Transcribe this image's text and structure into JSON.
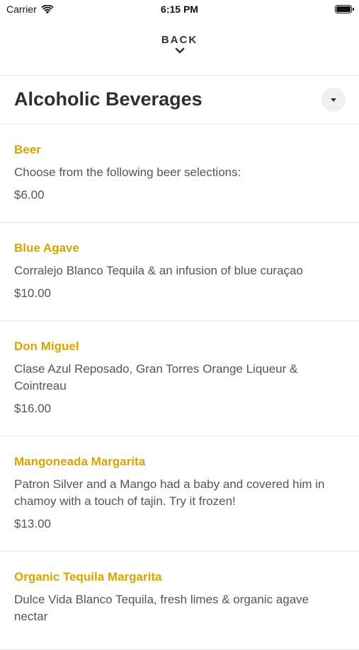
{
  "status_bar": {
    "carrier": "Carrier",
    "time": "6:15 PM"
  },
  "nav": {
    "back_label": "BACK"
  },
  "header": {
    "title": "Alcoholic Beverages"
  },
  "menu_items": [
    {
      "name": "Beer",
      "description": "Choose from the following beer selections:",
      "price": "$6.00"
    },
    {
      "name": "Blue Agave",
      "description": "Corralejo Blanco Tequila & an infusion of blue curaçao",
      "price": "$10.00"
    },
    {
      "name": "Don Miguel",
      "description": "Clase Azul Reposado, Gran Torres Orange Liqueur & Cointreau",
      "price": "$16.00"
    },
    {
      "name": "Mangoneada Margarita",
      "description": "Patron Silver and a Mango had a baby and covered him in chamoy with a touch of tajin. Try it frozen!",
      "price": "$13.00"
    },
    {
      "name": "Organic Tequila Margarita",
      "description": "Dulce Vida Blanco Tequila, fresh limes & organic agave nectar",
      "price": ""
    }
  ],
  "colors": {
    "item_name": "#d9a400",
    "text": "#555555",
    "title": "#2f2f2f"
  },
  "icons": {
    "wifi": "wifi-icon",
    "battery": "battery-icon",
    "back": "chevron-down-icon",
    "dropdown": "triangle-down-icon"
  }
}
